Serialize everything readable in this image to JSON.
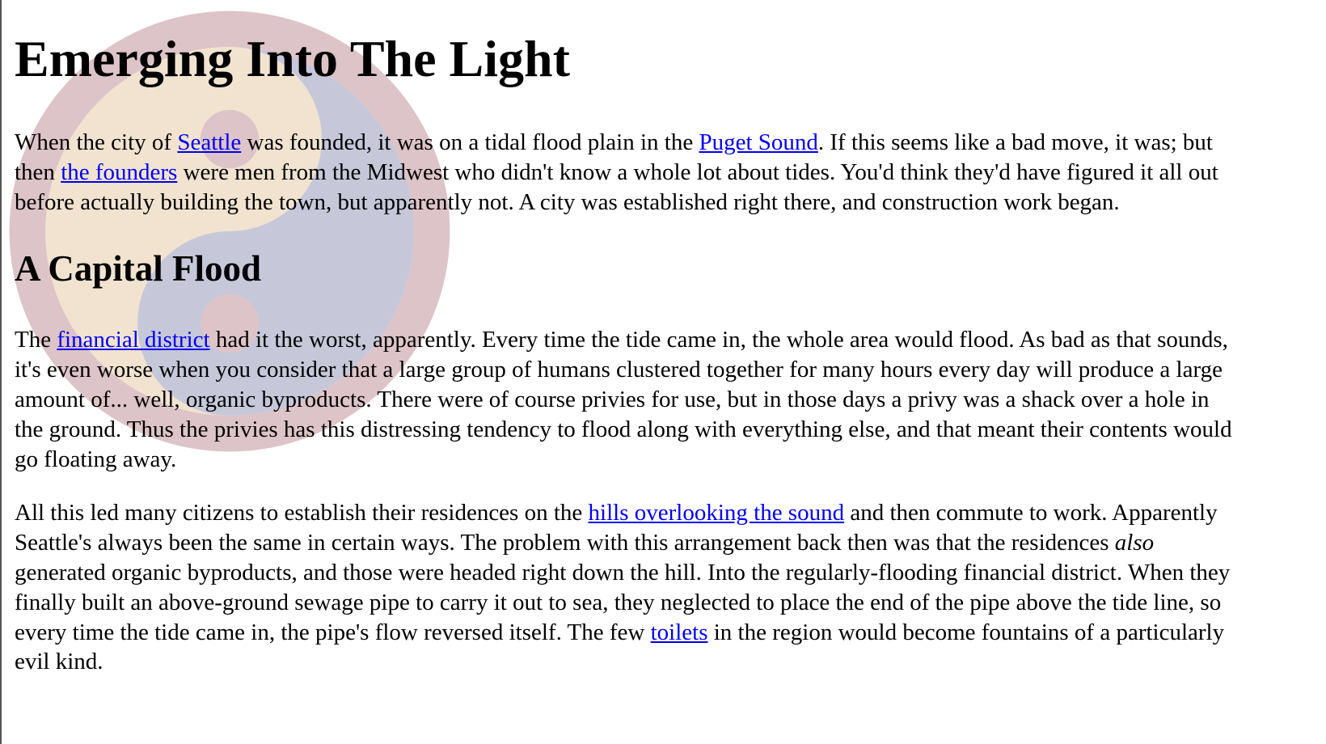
{
  "heading": "Emerging Into The Light",
  "p1": {
    "t1": "When the city of ",
    "l1": "Seattle",
    "t2": " was founded, it was on a tidal flood plain in the ",
    "l2": "Puget Sound",
    "t3": ". If this seems like a bad move, it was; but then ",
    "l3": "the founders",
    "t4": " were men from the Midwest who didn't know a whole lot about tides. You'd think they'd have figured it all out before actually building the town, but apparently not. A city was established right there, and construction work began."
  },
  "subheading": "A Capital Flood",
  "p2": {
    "t1": "The ",
    "l1": "financial district",
    "t2": " had it the worst, apparently. Every time the tide came in, the whole area would flood. As bad as that sounds, it's even worse when you consider that a large group of humans clustered together for many hours every day will produce a large amount of... well, organic byproducts. There were of course privies for use, but in those days a privy was a shack over a hole in the ground. Thus the privies has this distressing tendency to flood along with everything else, and that meant their contents would go floating away."
  },
  "p3": {
    "t1": "All this led many citizens to establish their residences on the ",
    "l1": "hills overlooking the sound",
    "t2": " and then commute to work. Apparently Seattle's always been the same in certain ways. The problem with this arrangement back then was that the residences ",
    "em": "also",
    "t3": " generated organic byproducts, and those were headed right down the hill. Into the regularly-flooding financial district. When they finally built an above-ground sewage pipe to carry it out to sea, they neglected to place the end of the pipe above the tide line, so every time the tide came in, the pipe's flow reversed itself. The few ",
    "l2": "toilets",
    "t4": " in the region would become fountains of a particularly evil kind."
  },
  "emblem": {
    "icon": "yin-yang-watermark",
    "ring_color": "#ddc4c8",
    "dark_color": "#c6c8da",
    "light_color": "#f1e3d0"
  }
}
